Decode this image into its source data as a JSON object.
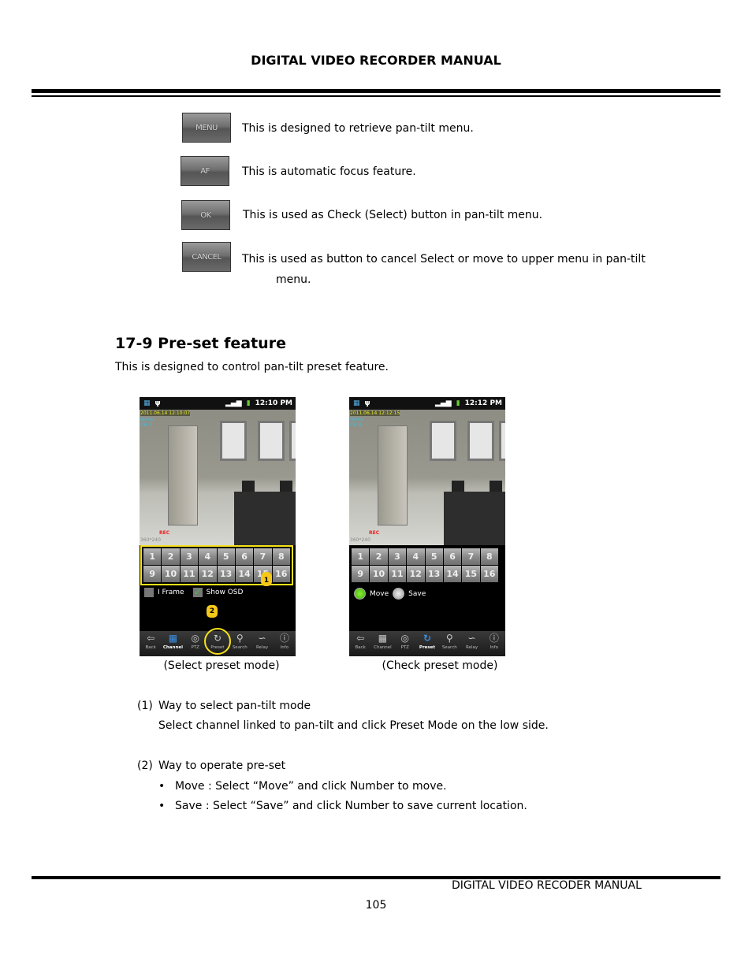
{
  "header": {
    "title": "DIGITAL VIDEO RECORDER MANUAL"
  },
  "buttons": [
    {
      "icon_label": "MENU",
      "text": "This is designed to retrieve pan-tilt menu."
    },
    {
      "icon_label": "AF",
      "text": "This is automatic focus feature."
    },
    {
      "icon_label": "OK",
      "text": "This is used as Check (Select) button in pan-tilt menu."
    },
    {
      "icon_label": "CANCEL",
      "text": "This is used as button to cancel Select or move to upper menu in pan-tilt",
      "text2": "menu."
    }
  ],
  "section": {
    "title": "17-9 Pre-set feature",
    "intro": "This is designed to control pan-tilt preset feature."
  },
  "phones": [
    {
      "time": "12:10 PM",
      "timestamp": "2011.06.14 12:10:07",
      "osd1": "demo",
      "osd2": "CH 3",
      "rec": "REC",
      "res": "360*240",
      "opt1": "I Frame",
      "opt2": "Show OSD",
      "caption": "(Select preset mode)",
      "marker1": "1",
      "marker2": "2"
    },
    {
      "time": "12:12 PM",
      "timestamp": "2011.06.14 12:12:15",
      "osd1": "demo",
      "osd2": "CH 3",
      "rec": "REC",
      "res": "360*240",
      "opt1": "Move",
      "opt2": "Save",
      "caption": "(Check preset mode)"
    }
  ],
  "numbers": [
    "1",
    "2",
    "3",
    "4",
    "5",
    "6",
    "7",
    "8",
    "9",
    "10",
    "11",
    "12",
    "13",
    "14",
    "15",
    "16"
  ],
  "nav": [
    "Back",
    "Channel",
    "PTZ",
    "Preset",
    "Search",
    "Relay",
    "Info"
  ],
  "steps": [
    {
      "num": "(1)",
      "title": "Way to select pan-tilt mode",
      "body": "Select channel linked to pan-tilt and click Preset Mode on the low side."
    },
    {
      "num": "(2)",
      "title": "Way to operate pre-set",
      "bullets": [
        "Move : Select “Move” and click Number to move.",
        "Save : Select “Save” and click Number to save current location."
      ]
    }
  ],
  "footer": {
    "title": "DIGITAL VIDEO RECODER MANUAL",
    "page": "105"
  },
  "colors": {
    "highlight": "#f5e11a",
    "active_nav": "#3b8fe0",
    "radio_on": "#5fc21a"
  }
}
